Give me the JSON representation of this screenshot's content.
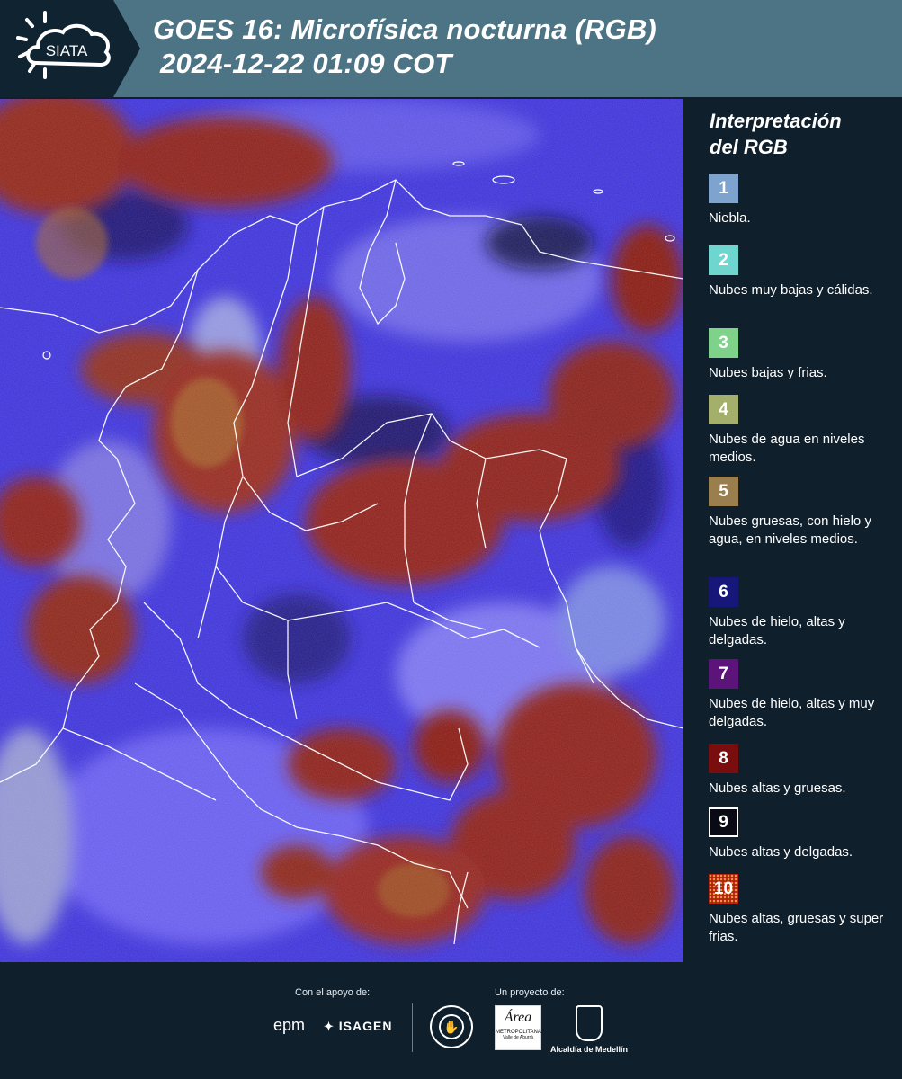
{
  "header": {
    "logo_text": "SIATA",
    "title_line1": "GOES 16: Microfísica nocturna (RGB)",
    "title_line2": "2024-12-22 01:09 COT",
    "logo_icon": "sun-cloud-icon"
  },
  "legend": {
    "title_line1": "Interpretación",
    "title_line2": "del RGB",
    "items": [
      {
        "number": "1",
        "color": "#7ea3cf",
        "label": "Niebla."
      },
      {
        "number": "2",
        "color": "#6fd6cf",
        "label": "Nubes muy bajas y cálidas."
      },
      {
        "number": "3",
        "color": "#7ed28a",
        "label": "Nubes bajas y frias."
      },
      {
        "number": "4",
        "color": "#a3af6b",
        "label": "Nubes de agua en niveles medios."
      },
      {
        "number": "5",
        "color": "#9a7e4e",
        "label": "Nubes gruesas, con hielo y agua, en niveles medios."
      },
      {
        "number": "6",
        "color": "#17177a",
        "label": "Nubes de hielo, altas y delgadas."
      },
      {
        "number": "7",
        "color": "#5c137a",
        "label": "Nubes de hielo, altas y muy delgadas."
      },
      {
        "number": "8",
        "color": "#7a0e0e",
        "label": "Nubes altas y gruesas."
      },
      {
        "number": "9",
        "color": "#0a0a14",
        "label": "Nubes altas y delgadas."
      },
      {
        "number": "10",
        "color": "#b21e10",
        "label": "Nubes altas, gruesas y super frias."
      }
    ]
  },
  "footer": {
    "support_label": "Con el apoyo de:",
    "project_label": "Un proyecto de:",
    "sponsors": {
      "epm": "epm",
      "isagen": "ISAGEN",
      "area_top": "Área",
      "area_bottom": "METROPOLITANA",
      "area_sub": "Valle de Aburrá",
      "alcaldia": "Alcaldía de Medellín"
    }
  },
  "colors": {
    "header_bg": "#4d7485",
    "page_bg": "#0f1f2c",
    "map_blue": "#3b2ee0",
    "map_red": "#8a1a14"
  }
}
